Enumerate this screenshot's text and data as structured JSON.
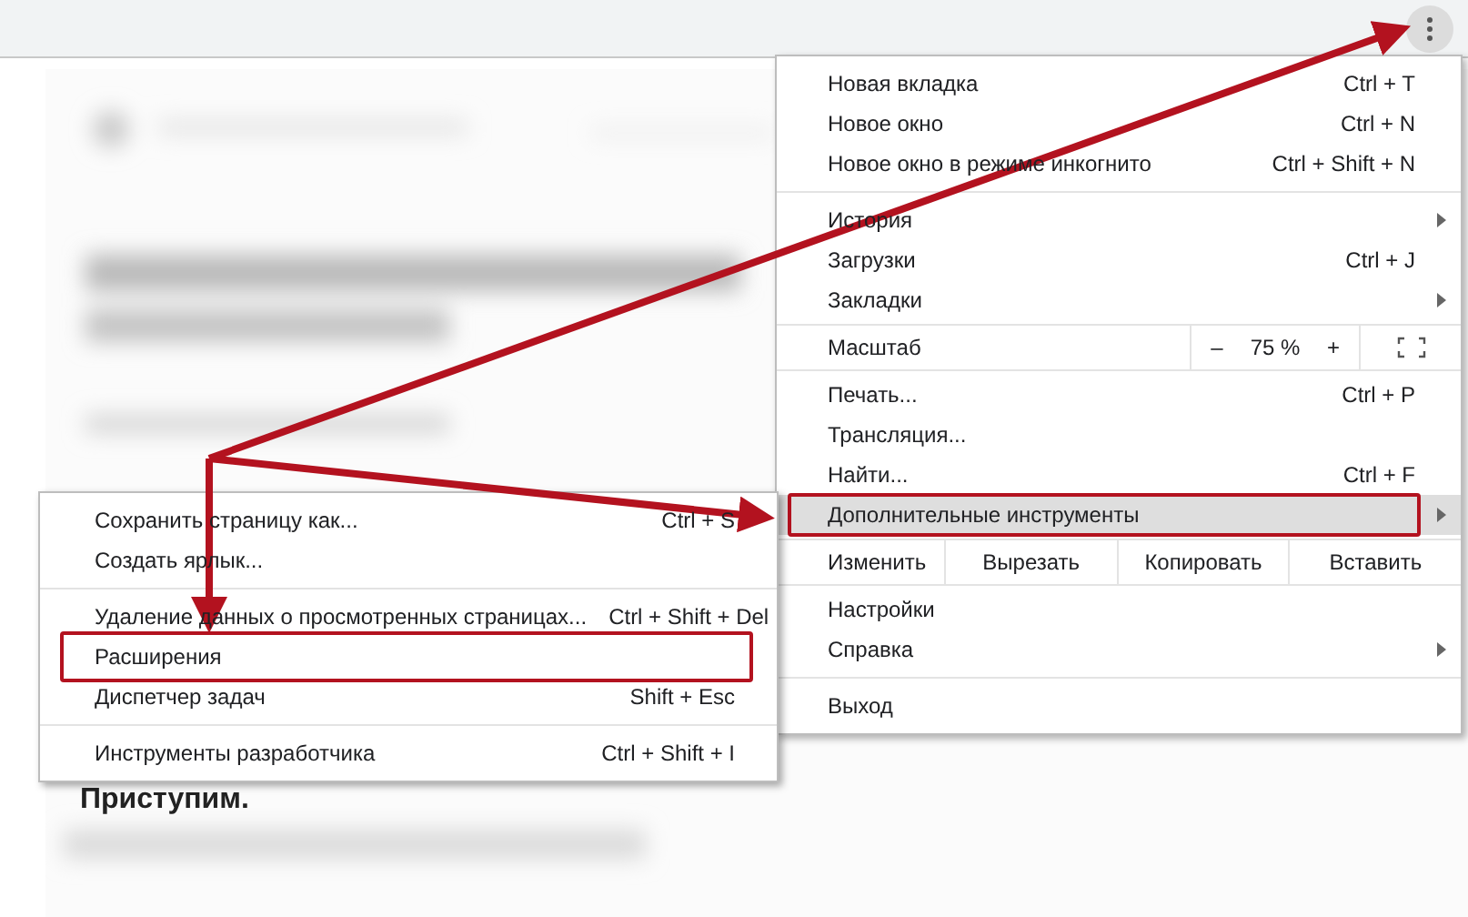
{
  "page": {
    "heading": "Приступим."
  },
  "menu": {
    "items": [
      {
        "kind": "item",
        "label": "Новая вкладка",
        "shortcut": "Ctrl + T",
        "has_submenu": false,
        "selected": false,
        "boxed": false
      },
      {
        "kind": "item",
        "label": "Новое окно",
        "shortcut": "Ctrl + N",
        "has_submenu": false,
        "selected": false,
        "boxed": false
      },
      {
        "kind": "item",
        "label": "Новое окно в режиме инкогнито",
        "shortcut": "Ctrl + Shift + N",
        "has_submenu": false,
        "selected": false,
        "boxed": false
      },
      {
        "kind": "separator"
      },
      {
        "kind": "item",
        "label": "История",
        "has_submenu": true,
        "selected": false,
        "boxed": false
      },
      {
        "kind": "item",
        "label": "Загрузки",
        "shortcut": "Ctrl + J",
        "has_submenu": false,
        "selected": false,
        "boxed": false
      },
      {
        "kind": "item",
        "label": "Закладки",
        "has_submenu": true,
        "selected": false,
        "boxed": false
      },
      {
        "kind": "zoom",
        "label": "Масштаб",
        "minus": "–",
        "value": "75 %",
        "plus": "+"
      },
      {
        "kind": "item",
        "label": "Печать...",
        "shortcut": "Ctrl + P",
        "has_submenu": false,
        "selected": false,
        "boxed": false
      },
      {
        "kind": "item",
        "label": "Трансляция...",
        "has_submenu": false,
        "selected": false,
        "boxed": false
      },
      {
        "kind": "item",
        "label": "Найти...",
        "shortcut": "Ctrl + F",
        "has_submenu": false,
        "selected": false,
        "boxed": false
      },
      {
        "kind": "item",
        "label": "Дополнительные инструменты",
        "has_submenu": true,
        "selected": true,
        "boxed": true
      },
      {
        "kind": "edit",
        "label": "Изменить",
        "buttons": [
          "Вырезать",
          "Копировать",
          "Вставить"
        ]
      },
      {
        "kind": "item",
        "label": "Настройки",
        "has_submenu": false,
        "selected": false,
        "boxed": false
      },
      {
        "kind": "item",
        "label": "Справка",
        "has_submenu": true,
        "selected": false,
        "boxed": false
      },
      {
        "kind": "separator"
      },
      {
        "kind": "item",
        "label": "Выход",
        "has_submenu": false,
        "selected": false,
        "boxed": false
      }
    ]
  },
  "submenu": {
    "items": [
      {
        "kind": "item",
        "label": "Сохранить страницу как...",
        "shortcut": "Ctrl + S",
        "selected": false,
        "boxed": false
      },
      {
        "kind": "item",
        "label": "Создать ярлык...",
        "selected": false,
        "boxed": false
      },
      {
        "kind": "separator"
      },
      {
        "kind": "item",
        "label": "Удаление данных о просмотренных страницах...",
        "shortcut": "Ctrl + Shift + Del",
        "selected": false,
        "boxed": false
      },
      {
        "kind": "item",
        "label": "Расширения",
        "selected": false,
        "boxed": true
      },
      {
        "kind": "item",
        "label": "Диспетчер задач",
        "shortcut": "Shift + Esc",
        "selected": false,
        "boxed": false
      },
      {
        "kind": "separator"
      },
      {
        "kind": "item",
        "label": "Инструменты разработчика",
        "shortcut": "Ctrl + Shift + I",
        "selected": false,
        "boxed": false
      }
    ]
  }
}
